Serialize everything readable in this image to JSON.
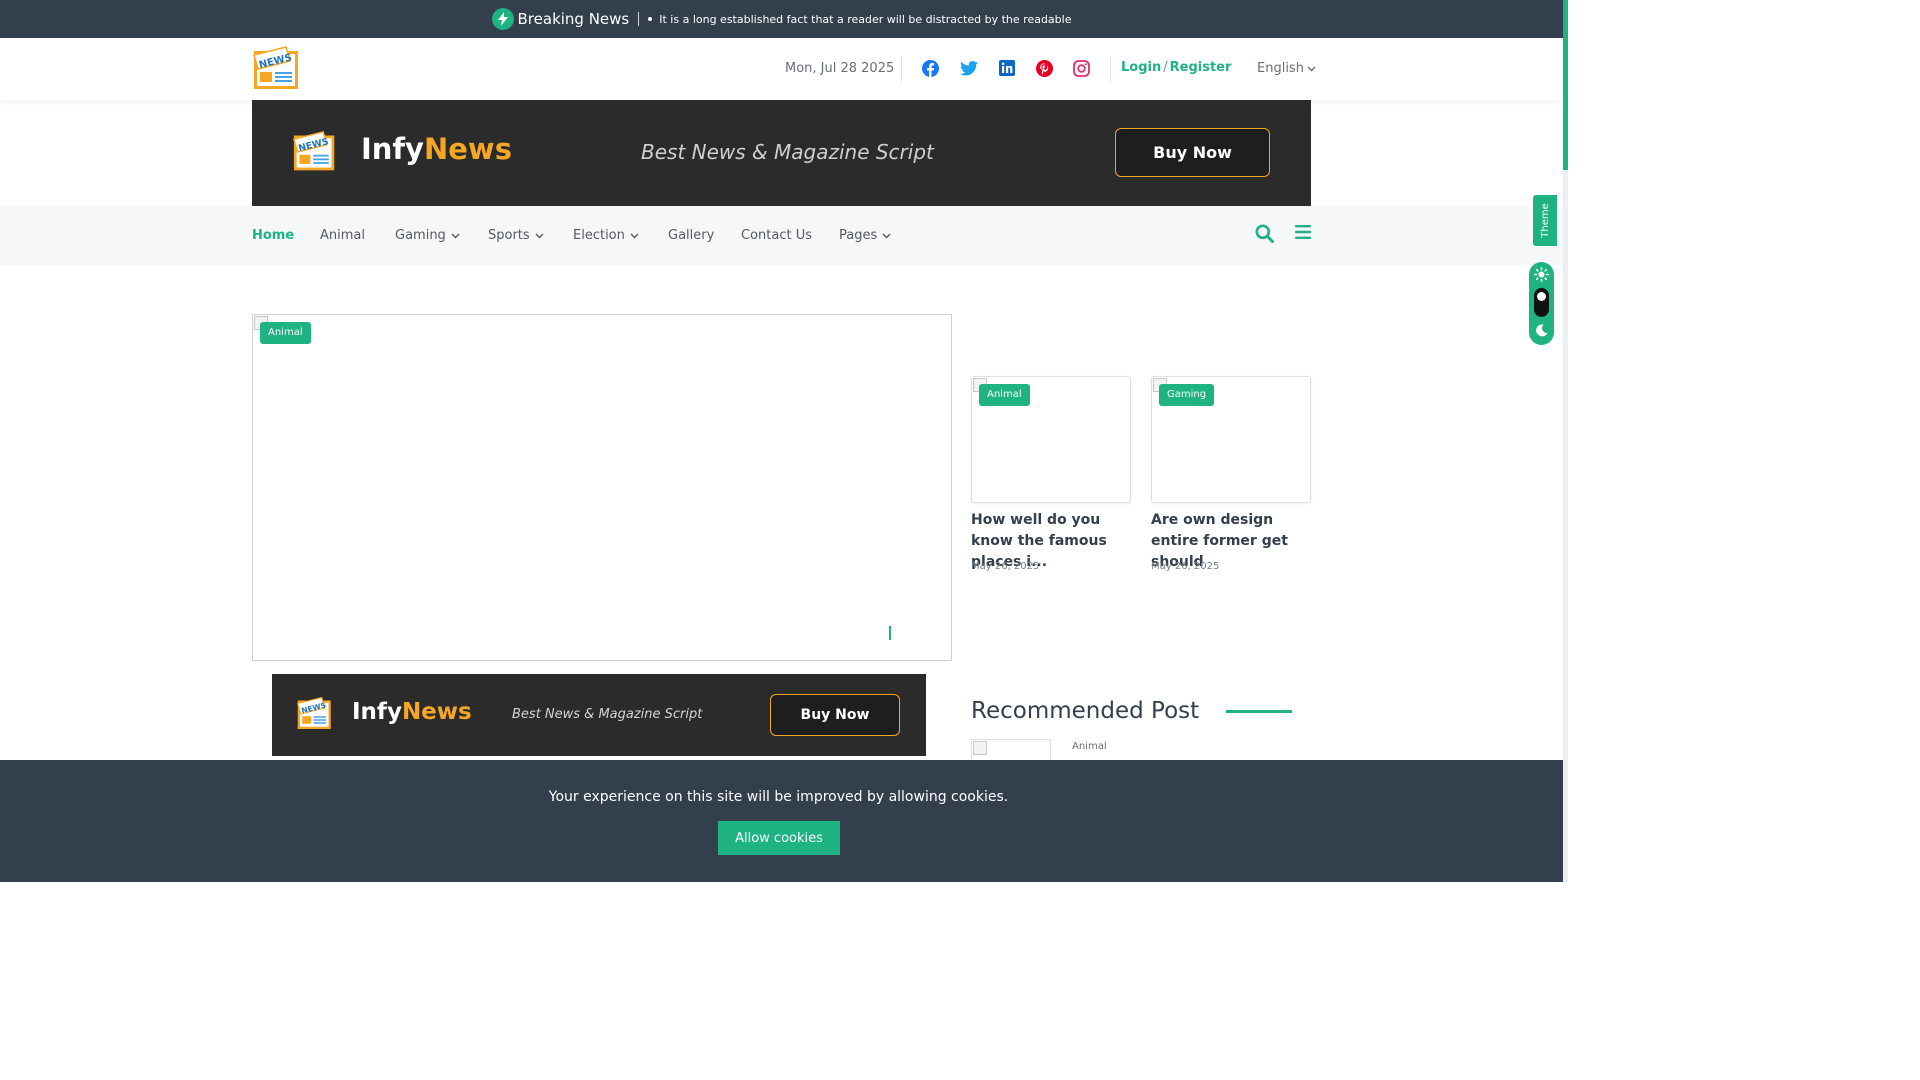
{
  "breaking": {
    "label": "Breaking News",
    "text": "It is a long established fact that a reader will be distracted by the readable"
  },
  "header": {
    "logo_text": "NEWS",
    "date": "Mon, Jul 28 2025",
    "social": [
      "facebook-icon",
      "twitter-icon",
      "linkedin-icon",
      "pinterest-icon",
      "instagram-icon"
    ],
    "login": "Login",
    "separator": "/",
    "register": "Register",
    "language": "English"
  },
  "banner": {
    "logo_text": "NEWS",
    "brand_main": "Infy",
    "brand_accent": "News",
    "tagline": "Best News & Magazine Script",
    "cta": "Buy Now"
  },
  "nav": {
    "items": [
      {
        "label": "Home"
      },
      {
        "label": "Animal"
      },
      {
        "label": "Gaming"
      },
      {
        "label": "Sports"
      },
      {
        "label": "Election"
      },
      {
        "label": "Gallery"
      },
      {
        "label": "Contact Us"
      },
      {
        "label": "Pages"
      }
    ]
  },
  "hero": {
    "category": "Animal"
  },
  "cards": [
    {
      "category": "Animal",
      "title": "How well do you know the famous places i...",
      "date": "May 26, 2025"
    },
    {
      "category": "Gaming",
      "title": "Are own design entire former get should",
      "date": "May 26, 2025"
    }
  ],
  "recommended": {
    "title": "Recommended Post",
    "first_category": "Animal"
  },
  "cookie": {
    "message": "Your experience on this site will be improved by allowing cookies.",
    "button": "Allow cookies"
  },
  "theme": {
    "label": "Theme"
  },
  "colors": {
    "accent": "#1fb381",
    "brand_orange": "#f5a623",
    "dark_bar": "#333f4d",
    "banner_bg": "#2b2b2b"
  }
}
